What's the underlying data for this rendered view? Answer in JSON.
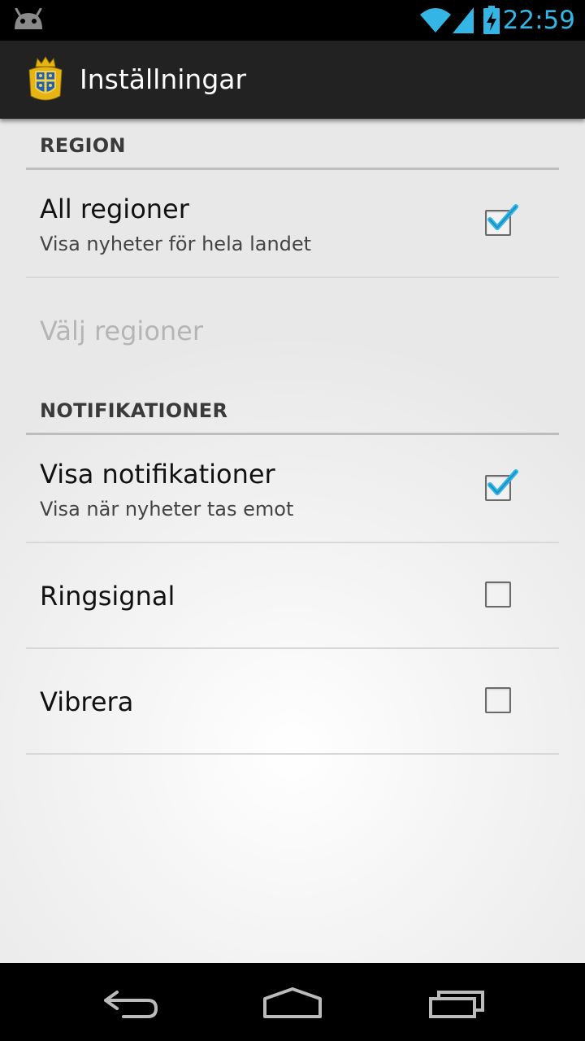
{
  "status_bar": {
    "time": "22:59",
    "icons": [
      "android-icon",
      "wifi-icon",
      "signal-icon",
      "battery-charging-icon"
    ]
  },
  "action_bar": {
    "title": "Inställningar",
    "logo_icon": "coat-of-arms-icon"
  },
  "settings": {
    "region_header": "REGION",
    "all_regions": {
      "title": "All regioner",
      "summary": "Visa nyheter för hela landet",
      "checked": true
    },
    "choose_regions": {
      "title": "Välj regioner",
      "enabled": false
    },
    "notifications_header": "NOTIFIKATIONER",
    "show_notifications": {
      "title": "Visa notifikationer",
      "summary": "Visa när nyheter tas emot",
      "checked": true
    },
    "ringtone": {
      "title": "Ringsignal",
      "checked": false
    },
    "vibrate": {
      "title": "Vibrera",
      "checked": false
    }
  },
  "colors": {
    "accent": "#33b5e5",
    "action_bar": "#222222"
  },
  "nav_bar": {
    "icons": [
      "back-icon",
      "home-icon",
      "recent-apps-icon"
    ]
  }
}
